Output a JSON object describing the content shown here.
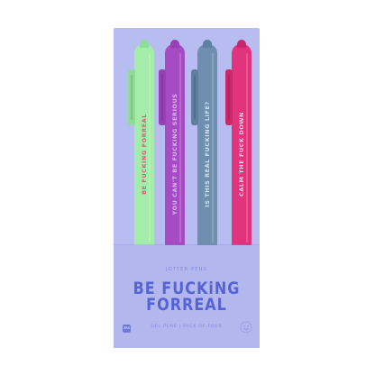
{
  "product": {
    "pens": [
      {
        "text": "BE FUCKING FORREAL",
        "body_color": "#a3ecaa",
        "text_color": "#e6557f"
      },
      {
        "text": "YOU CAN'T BE FUCKING SERIOUS",
        "body_color": "#a64bc4",
        "text_color": "#d9b8ea"
      },
      {
        "text": "IS THIS REAL FUCKING LIFE?",
        "body_color": "#6e8faf",
        "text_color": "#d6e2ee"
      },
      {
        "text": "CALM THE FUCK DOWN",
        "body_color": "#e1347c",
        "text_color": "#fbd3e3"
      }
    ],
    "sleeve": {
      "brand": "JOTTER PENS",
      "headline_line1": "BE FUCKiNG",
      "headline_line2": "FORREAL",
      "subline": "GEL PENS | PACK OF FOUR",
      "logo_text": "3RS"
    },
    "card_color": "#b7bdf0",
    "accent_color": "#5663d6"
  }
}
